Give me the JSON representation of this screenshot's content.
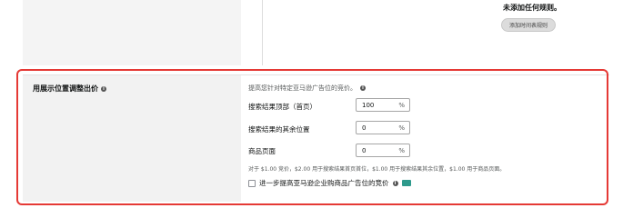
{
  "top": {
    "no_rules_text": "未添加任何规则。",
    "add_schedule_button": "添加时间表规则"
  },
  "section": {
    "title": "用展示位置调整出价",
    "description": "提高您针对特定亚马逊广告位的竞价。",
    "rows": [
      {
        "label": "搜索结果顶部（首页）",
        "value": "100",
        "unit": "%"
      },
      {
        "label": "搜索结果的其余位置",
        "value": "0",
        "unit": "%"
      },
      {
        "label": "商品页面",
        "value": "0",
        "unit": "%"
      }
    ],
    "example": "对于 $1.00 竞价，$2.00 用于搜索结果首页首位，$1.00 用于搜索结果其余位置，$1.00 用于商品页面。",
    "checkbox_label": "进一步提高亚马逊企业购商品广告位的竞价",
    "info_glyph": "i"
  },
  "colors": {
    "highlight": "#e53935",
    "badge": "#2e9a8c"
  }
}
